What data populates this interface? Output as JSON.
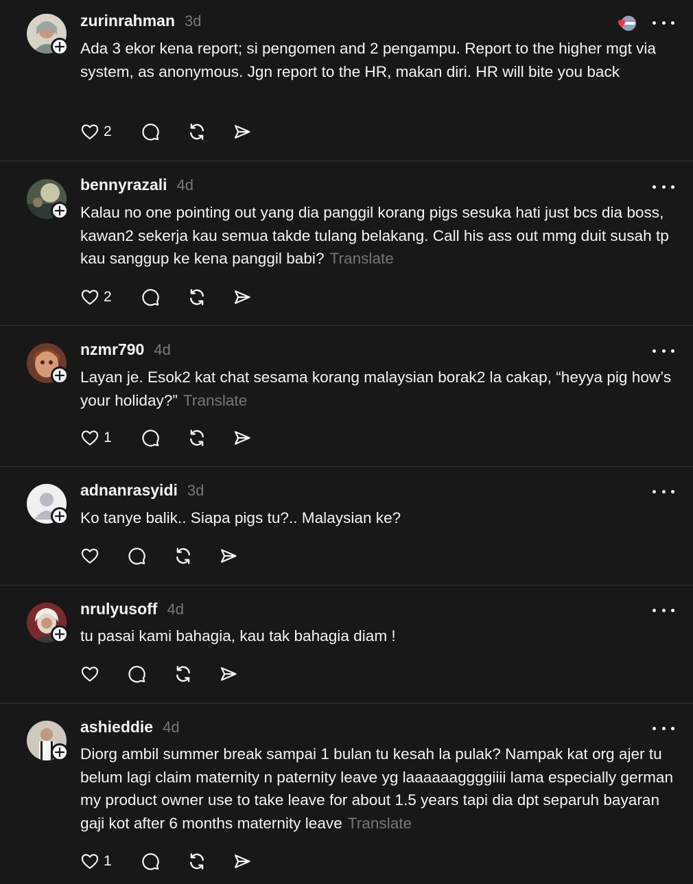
{
  "posts": [
    {
      "username": "zurinrahman",
      "time": "3d",
      "text": "Ada 3 ekor kena report; si pengomen and 2 pengampu. Report to the higher mgt via system, as anonymous. Jgn report to the HR, makan diri. HR will bite you back",
      "translate": "",
      "likes": "2",
      "avatar_icon": "user-photo-avatar"
    },
    {
      "username": "bennyrazali",
      "time": "4d",
      "text": "Kalau no one pointing out yang dia panggil korang pigs sesuka hati just bcs dia boss, kawan2 sekerja kau semua takde tulang belakang. Call his ass out mmg duit susah tp kau sanggup ke kena panggil babi?",
      "translate": "Translate",
      "likes": "2",
      "avatar_icon": "user-photo-avatar"
    },
    {
      "username": "nzmr790",
      "time": "4d",
      "text": "Layan je. Esok2 kat chat sesama korang malaysian borak2 la cakap, “heyya pig how’s your holiday?”",
      "translate": "Translate",
      "likes": "1",
      "avatar_icon": "user-photo-avatar"
    },
    {
      "username": "adnanrasyidi",
      "time": "3d",
      "text": "Ko tanye balik.. Siapa pigs tu?.. Malaysian ke?",
      "translate": "",
      "likes": "",
      "avatar_icon": "default-user-avatar"
    },
    {
      "username": "nrulyusoff",
      "time": "4d",
      "text": "tu pasai kami bahagia, kau tak bahagia diam !",
      "translate": "",
      "likes": "",
      "avatar_icon": "user-photo-avatar"
    },
    {
      "username": "ashieddie",
      "time": "4d",
      "text": "Diorg ambil summer break sampai 1 bulan tu kesah la pulak? Nampak kat org ajer tu belum lagi claim maternity n paternity leave yg laaaaaaggggiiii lama especially german my product owner use to take leave for about 1.5 years tapi dia dpt separuh bayaran gaji kot after 6 months maternity leave",
      "translate": "Translate",
      "likes": "1",
      "avatar_icon": "user-photo-avatar"
    }
  ],
  "icons": {
    "like": "heart-icon",
    "reply": "comment-icon",
    "repost": "repost-icon",
    "share": "send-icon",
    "more": "more-options-icon",
    "follow": "plus-icon"
  },
  "colors": {
    "background": "#181818",
    "text": "#f3f5f7",
    "muted": "#777777",
    "divider": "#333638",
    "like_badge": "#ff3040"
  }
}
